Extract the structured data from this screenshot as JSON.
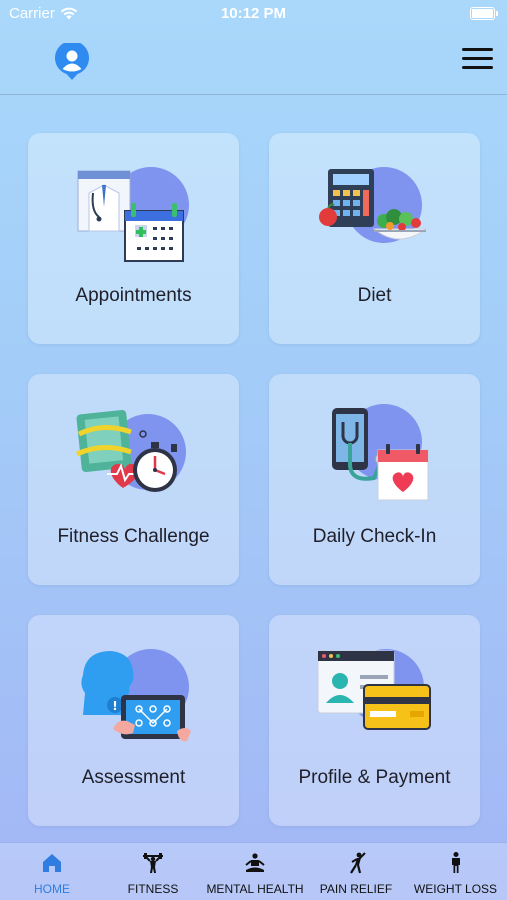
{
  "status_bar": {
    "carrier": "Carrier",
    "time": "10:12 PM",
    "icons": [
      "wifi-icon",
      "battery-icon"
    ]
  },
  "header": {
    "profile_icon": "user-location-pin-icon",
    "menu_icon": "hamburger-menu-icon",
    "profile_color": "#2f8bf0"
  },
  "cards": [
    {
      "label": "Appointments",
      "icon": "doctor-calendar-icon"
    },
    {
      "label": "Diet",
      "icon": "calculator-food-icon"
    },
    {
      "label": "Fitness Challenge",
      "icon": "scale-stopwatch-icon"
    },
    {
      "label": "Daily Check-In",
      "icon": "phone-stethoscope-calendar-icon"
    },
    {
      "label": "Assessment",
      "icon": "head-tablet-icon"
    },
    {
      "label": "Profile & Payment",
      "icon": "id-card-credit-card-icon"
    }
  ],
  "tabbar": {
    "active_color": "#2f7de0",
    "tabs": [
      {
        "label": "HOME",
        "icon": "home-icon",
        "active": true
      },
      {
        "label": "FITNESS",
        "icon": "dumbbell-icon",
        "active": false
      },
      {
        "label": "MENTAL HEALTH",
        "icon": "meditation-icon",
        "active": false
      },
      {
        "label": "PAIN RELIEF",
        "icon": "stretch-icon",
        "active": false
      },
      {
        "label": "WEIGHT LOSS",
        "icon": "person-icon",
        "active": false
      }
    ]
  }
}
